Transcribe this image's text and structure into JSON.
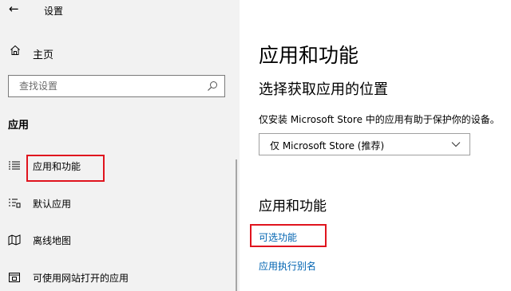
{
  "window": {
    "title": "设置"
  },
  "sidebar": {
    "home_label": "主页",
    "search_placeholder": "查找设置",
    "section_heading": "应用",
    "items": [
      {
        "label": "应用和功能",
        "icon": "apps-features-icon",
        "selected": true
      },
      {
        "label": "默认应用",
        "icon": "default-apps-icon"
      },
      {
        "label": "离线地图",
        "icon": "offline-maps-icon"
      },
      {
        "label": "可使用网站打开的应用",
        "icon": "apps-for-websites-icon"
      }
    ]
  },
  "main": {
    "title": "应用和功能",
    "install_location": {
      "heading": "选择获取应用的位置",
      "description": "仅安装 Microsoft Store 中的应用有助于保护你的设备。",
      "selected_option": "仅 Microsoft Store (推荐)"
    },
    "apps_section": {
      "heading": "应用和功能",
      "links": [
        {
          "label": "可选功能",
          "highlighted": true
        },
        {
          "label": "应用执行别名"
        }
      ]
    }
  },
  "colors": {
    "link": "#0063b1",
    "highlight": "#e0141e",
    "sidebar_bg": "#f2f2f2"
  }
}
